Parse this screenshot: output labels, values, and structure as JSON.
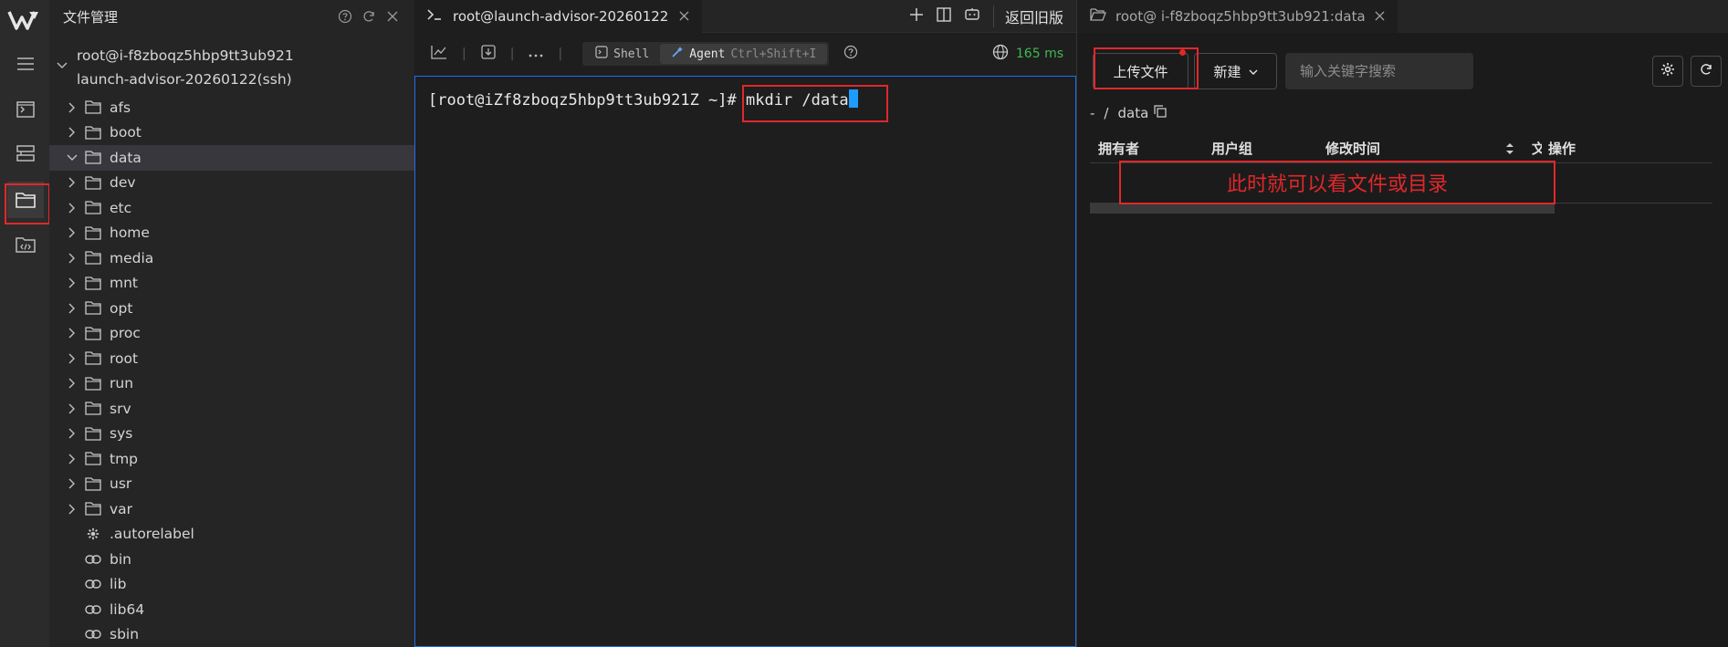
{
  "sidebar": {
    "title": "文件管理",
    "host": {
      "line1": "root@i-f8zboqz5hbp9tt3ub921",
      "line2": "launch-advisor-20260122(ssh)"
    },
    "folders": [
      "afs",
      "boot",
      "data",
      "dev",
      "etc",
      "home",
      "media",
      "mnt",
      "opt",
      "proc",
      "root",
      "run",
      "srv",
      "sys",
      "tmp",
      "usr",
      "var"
    ],
    "selected": "data",
    "files": [
      {
        "name": ".autorelabel",
        "icon": "gear-icon"
      },
      {
        "name": "bin",
        "icon": "link-icon"
      },
      {
        "name": "lib",
        "icon": "link-icon"
      },
      {
        "name": "lib64",
        "icon": "link-icon"
      },
      {
        "name": "sbin",
        "icon": "link-icon"
      }
    ]
  },
  "terminal": {
    "tab_title": "root@launch-advisor-20260122",
    "back_label": "返回旧版",
    "mode_shell": "Shell",
    "mode_agent": "Agent",
    "agent_shortcut": "Ctrl+Shift+I",
    "latency": "165 ms",
    "prompt": "[root@iZf8zboqz5hbp9tt3ub921Z ~]",
    "command": "# mkdir /data"
  },
  "file_manager": {
    "tab_title": "root@ i-f8zboqz5hbp9tt3ub921:data",
    "upload_label": "上传文件",
    "new_label": "新建",
    "search_placeholder": "输入关键字搜索",
    "breadcrumb_root": "-",
    "breadcrumb_sep": "/",
    "breadcrumb_current": "data",
    "columns": {
      "owner": "拥有者",
      "group": "用户组",
      "modified": "修改时间",
      "truncated": "文",
      "actions": "操作"
    },
    "annotation": "此时就可以看文件或目录"
  },
  "colors": {
    "highlight_red": "#e0282b",
    "accent_blue": "#1f6feb",
    "latency_green": "#3fb950",
    "cursor_blue": "#1e9bff"
  }
}
